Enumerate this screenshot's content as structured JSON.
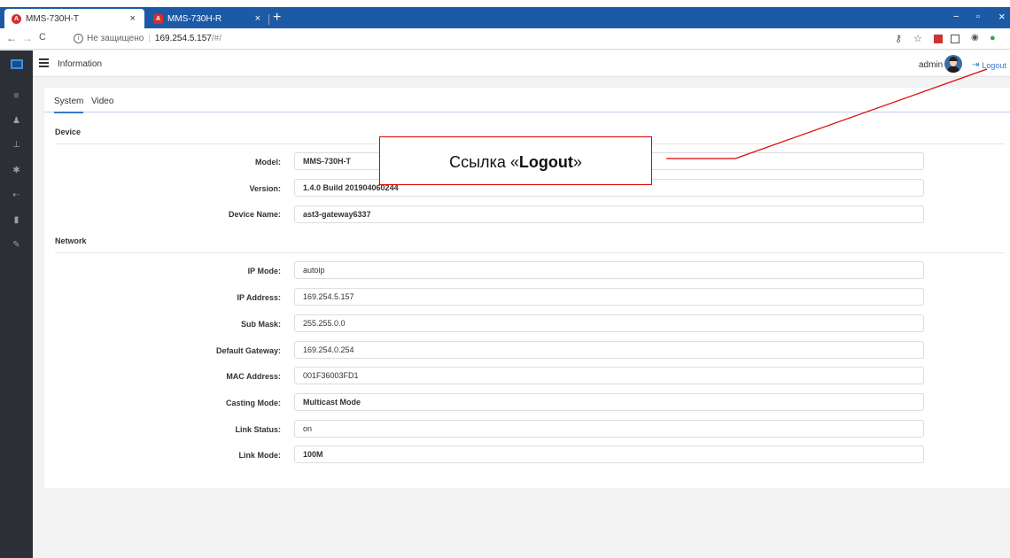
{
  "browser": {
    "tabs": [
      {
        "title": "MMS-730H-T",
        "close": "×"
      },
      {
        "title": "MMS-730H-R",
        "close": "×"
      }
    ],
    "new_tab": "+",
    "window_controls": {
      "minimize": "−",
      "restore": "▫",
      "close": "×"
    },
    "address": {
      "back": "←",
      "forward": "→",
      "reload": "C",
      "security_text": "Не защищено",
      "host": "169.254.5.157",
      "path": "/#/"
    }
  },
  "header": {
    "title": "Information",
    "username": "admin",
    "logout_label": "Logout"
  },
  "sidebar": {
    "items": [
      {
        "icon": "list-icon",
        "glyph": "≡"
      },
      {
        "icon": "user-icon",
        "glyph": "♟"
      },
      {
        "icon": "network-icon",
        "glyph": "⊥"
      },
      {
        "icon": "gear-icon",
        "glyph": "✱"
      },
      {
        "icon": "usb-icon",
        "glyph": "⇠"
      },
      {
        "icon": "database-icon",
        "glyph": "▮"
      },
      {
        "icon": "wrench-icon",
        "glyph": "✎"
      }
    ]
  },
  "main": {
    "tabs": [
      {
        "label": "System"
      },
      {
        "label": "Video"
      }
    ],
    "device": {
      "heading": "Device",
      "fields": [
        {
          "label": "Model:",
          "value": "MMS-730H-T"
        },
        {
          "label": "Version:",
          "value": "1.4.0 Build 201904060244"
        },
        {
          "label": "Device Name:",
          "value": "ast3-gateway6337"
        }
      ]
    },
    "network": {
      "heading": "Network",
      "fields": [
        {
          "label": "IP Mode:",
          "value": "autoip"
        },
        {
          "label": "IP Address:",
          "value": "169.254.5.157"
        },
        {
          "label": "Sub Mask:",
          "value": "255.255.0.0"
        },
        {
          "label": "Default Gateway:",
          "value": "169.254.0.254"
        },
        {
          "label": "MAC Address:",
          "value": "001F36003FD1"
        },
        {
          "label": "Casting Mode:",
          "value": "Multicast Mode"
        },
        {
          "label": "Link Status:",
          "value": "on"
        },
        {
          "label": "Link Mode:",
          "value": "100M"
        }
      ]
    }
  },
  "annotation": {
    "prefix": "Ссылка «",
    "bold": "Logout",
    "suffix": "»",
    "color": "#dd0000"
  }
}
